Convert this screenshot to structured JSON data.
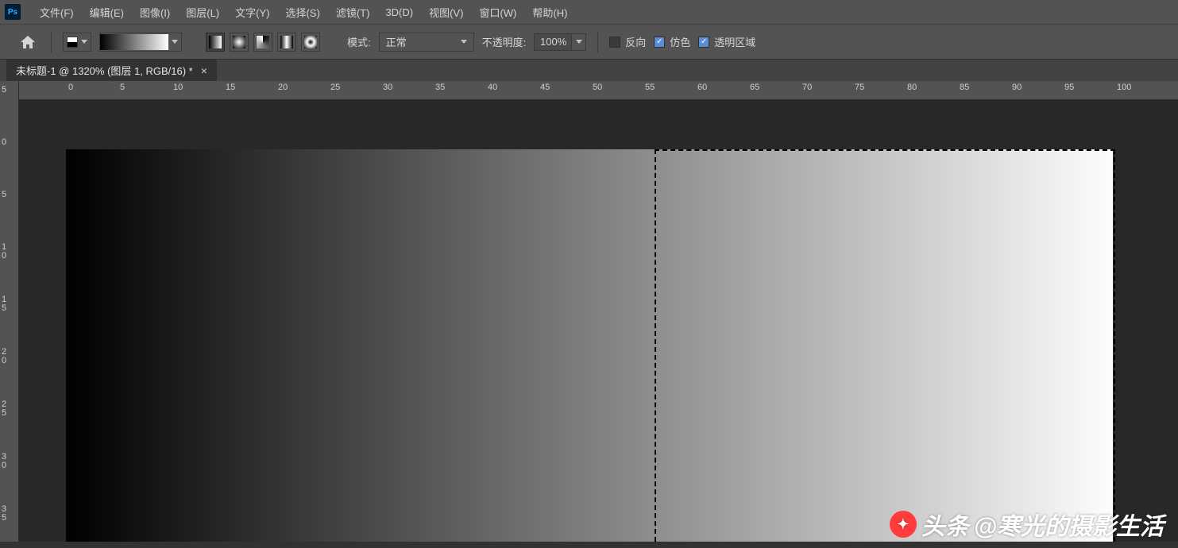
{
  "app": {
    "logo_text": "Ps"
  },
  "menu": {
    "file": "文件(F)",
    "edit": "编辑(E)",
    "image": "图像(I)",
    "layer": "图层(L)",
    "type": "文字(Y)",
    "select": "选择(S)",
    "filter": "滤镜(T)",
    "threed": "3D(D)",
    "view": "视图(V)",
    "window": "窗口(W)",
    "help": "帮助(H)"
  },
  "options": {
    "mode_label": "模式:",
    "mode_value": "正常",
    "opacity_label": "不透明度:",
    "opacity_value": "100%",
    "reverse_label": "反向",
    "dither_label": "仿色",
    "transparency_label": "透明区域",
    "reverse_checked": false,
    "dither_checked": true,
    "transparency_checked": true
  },
  "document": {
    "tab_title": "未标题-1 @ 1320% (图层 1, RGB/16) *"
  },
  "rulers": {
    "h": [
      "5",
      "0",
      "5",
      "10",
      "15",
      "20",
      "25",
      "30",
      "35",
      "40",
      "45",
      "50",
      "55",
      "60",
      "65",
      "70",
      "75",
      "80",
      "85",
      "90",
      "95",
      "100"
    ],
    "h_positions": [
      -40,
      60,
      125,
      192,
      258,
      324,
      390,
      456,
      522,
      588,
      654,
      720,
      786,
      852,
      918,
      984,
      1050,
      1116,
      1182,
      1248,
      1314,
      1380
    ],
    "v": [
      "5",
      "0",
      "5",
      "10",
      "15",
      "20",
      "25",
      "30",
      "35"
    ],
    "v_positions": [
      -4,
      62,
      128,
      194,
      260,
      326,
      392,
      458,
      524
    ]
  },
  "watermark": {
    "prefix": "头条",
    "text": "@寒光的摄影生活"
  }
}
